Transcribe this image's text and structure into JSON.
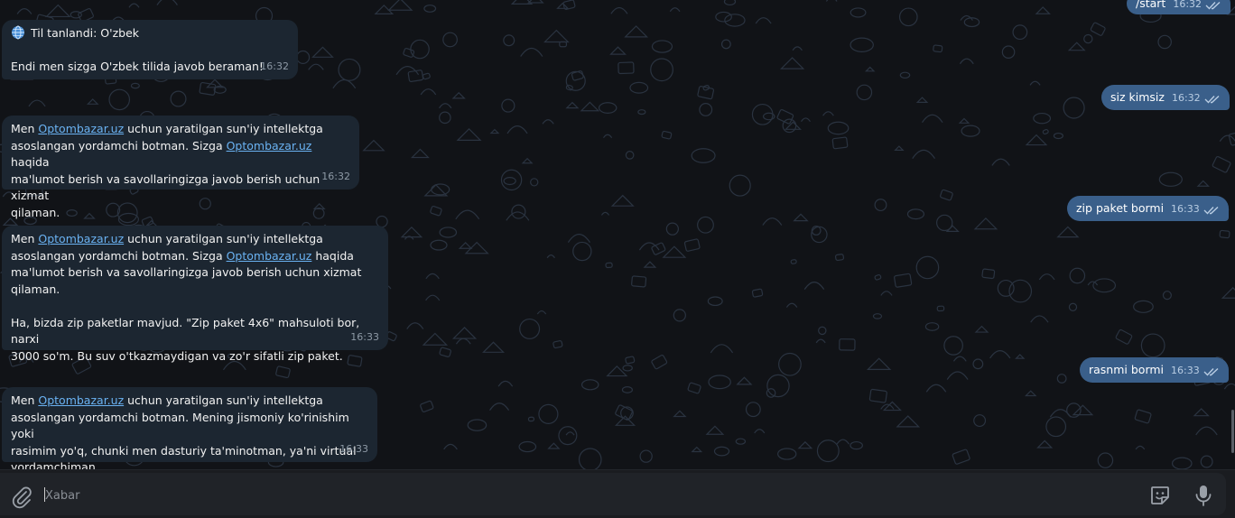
{
  "messages_in": [
    {
      "lines": [
        "Til tanlandi: O'zbek",
        "",
        "Endi men sizga O'zbek tilida javob beraman!"
      ],
      "time": "16:32"
    },
    {
      "segments": [
        {
          "t": "Men "
        },
        {
          "t": "Optombazar.uz",
          "link": true
        },
        {
          "t": " uchun yaratilgan sun'iy intellektga\nasoslangan yordamchi botman. Sizga "
        },
        {
          "t": "Optombazar.uz",
          "link": true
        },
        {
          "t": " haqida\nma'lumot berish va savollaringizga javob berish uchun xizmat\nqilaman."
        }
      ],
      "time": "16:32"
    },
    {
      "segments": [
        {
          "t": "Men "
        },
        {
          "t": "Optombazar.uz",
          "link": true
        },
        {
          "t": " uchun yaratilgan sun'iy intellektga\nasoslangan yordamchi botman. Sizga "
        },
        {
          "t": "Optombazar.uz",
          "link": true
        },
        {
          "t": " haqida\nma'lumot berish va savollaringizga javob berish uchun xizmat\nqilaman.\n\nHa, bizda zip paketlar mavjud. \"Zip paket 4x6\" mahsuloti bor, narxi\n3000 so'm. Bu suv o'tkazmaydigan va zo'r sifatli zip paket."
        }
      ],
      "time": "16:33"
    },
    {
      "segments": [
        {
          "t": "Men "
        },
        {
          "t": "Optombazar.uz",
          "link": true
        },
        {
          "t": " uchun yaratilgan sun'iy intellektga\nasoslangan yordamchi botman. Mening jismoniy ko'rinishim yoki\nrasimim yo'q, chunki men dasturiy ta'minotman, ya'ni virtual\nyordamchiman."
        }
      ],
      "time": "16:33"
    }
  ],
  "messages_out": [
    {
      "text": "/start",
      "time": "16:32"
    },
    {
      "text": "siz kimsiz",
      "time": "16:32"
    },
    {
      "text": "zip paket bormi",
      "time": "16:33"
    },
    {
      "text": "rasnmi bormi",
      "time": "16:33"
    }
  ],
  "composer": {
    "placeholder": "Xabar"
  },
  "icons": {
    "attach": "paperclip-icon",
    "emoji": "sticker-icon",
    "mic": "microphone-icon",
    "read": "double-check-icon",
    "lang": "globe-icon"
  },
  "colors": {
    "incoming_bubble": "#1c2631",
    "outgoing_bubble": "#3a5f8a",
    "link": "#6ab2f2"
  }
}
